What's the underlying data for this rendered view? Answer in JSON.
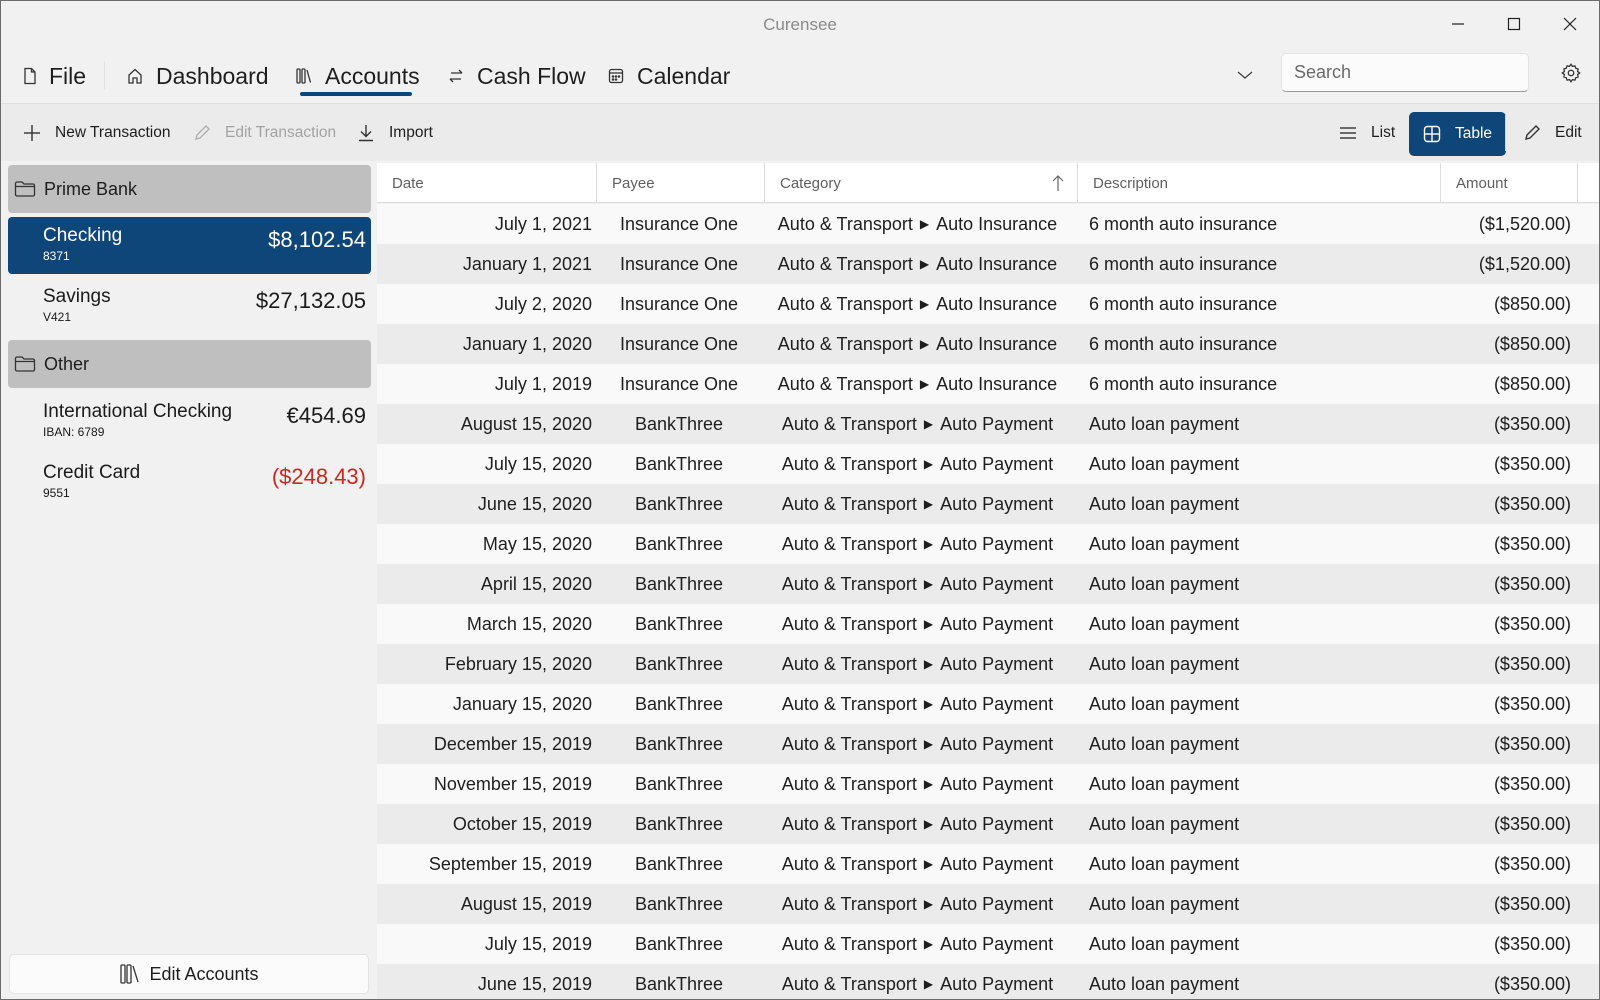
{
  "app": {
    "title": "Curensee"
  },
  "window_controls": {
    "minimize": "minimize-icon",
    "maximize": "maximize-icon",
    "close": "close-icon"
  },
  "nav": {
    "file": "File",
    "tabs": [
      {
        "label": "Dashboard",
        "icon": "home-icon"
      },
      {
        "label": "Accounts",
        "icon": "library-icon",
        "active": true
      },
      {
        "label": "Cash Flow",
        "icon": "swap-icon"
      },
      {
        "label": "Calendar",
        "icon": "calendar-icon"
      }
    ],
    "search_placeholder": "Search",
    "search_value": ""
  },
  "toolbar": {
    "new_transaction": "New Transaction",
    "edit_transaction": "Edit Transaction",
    "import": "Import",
    "list": "List",
    "table": "Table",
    "edit": "Edit",
    "active_view": "Table"
  },
  "sidebar": {
    "groups": [
      {
        "name": "Prime Bank",
        "accounts": [
          {
            "name": "Checking",
            "number": "8371",
            "balance": "$8,102.54",
            "selected": true
          },
          {
            "name": "Savings",
            "number": "V421",
            "balance": "$27,132.05"
          }
        ]
      },
      {
        "name": "Other",
        "accounts": [
          {
            "name": "International Checking",
            "number": "IBAN: 6789",
            "balance": "€454.69"
          },
          {
            "name": "Credit Card",
            "number": "9551",
            "balance": "($248.43)",
            "negative": true
          }
        ]
      }
    ],
    "edit_accounts": "Edit Accounts"
  },
  "table": {
    "columns": [
      "Date",
      "Payee",
      "Category",
      "Description",
      "Amount"
    ],
    "sorted_column": "Category",
    "sort_direction": "ascending",
    "rows": [
      {
        "date": "July 1, 2021",
        "payee": "Insurance One",
        "cat": "Auto & Transport",
        "sub": "Auto Insurance",
        "desc": "6 month auto insurance",
        "amount": "($1,520.00)"
      },
      {
        "date": "January 1, 2021",
        "payee": "Insurance One",
        "cat": "Auto & Transport",
        "sub": "Auto Insurance",
        "desc": "6 month auto insurance",
        "amount": "($1,520.00)"
      },
      {
        "date": "July 2, 2020",
        "payee": "Insurance One",
        "cat": "Auto & Transport",
        "sub": "Auto Insurance",
        "desc": "6 month auto insurance",
        "amount": "($850.00)"
      },
      {
        "date": "January 1, 2020",
        "payee": "Insurance One",
        "cat": "Auto & Transport",
        "sub": "Auto Insurance",
        "desc": "6 month auto insurance",
        "amount": "($850.00)"
      },
      {
        "date": "July 1, 2019",
        "payee": "Insurance One",
        "cat": "Auto & Transport",
        "sub": "Auto Insurance",
        "desc": "6 month auto insurance",
        "amount": "($850.00)"
      },
      {
        "date": "August 15, 2020",
        "payee": "BankThree",
        "cat": "Auto & Transport",
        "sub": "Auto Payment",
        "desc": "Auto loan payment",
        "amount": "($350.00)"
      },
      {
        "date": "July 15, 2020",
        "payee": "BankThree",
        "cat": "Auto & Transport",
        "sub": "Auto Payment",
        "desc": "Auto loan payment",
        "amount": "($350.00)"
      },
      {
        "date": "June 15, 2020",
        "payee": "BankThree",
        "cat": "Auto & Transport",
        "sub": "Auto Payment",
        "desc": "Auto loan payment",
        "amount": "($350.00)"
      },
      {
        "date": "May 15, 2020",
        "payee": "BankThree",
        "cat": "Auto & Transport",
        "sub": "Auto Payment",
        "desc": "Auto loan payment",
        "amount": "($350.00)"
      },
      {
        "date": "April 15, 2020",
        "payee": "BankThree",
        "cat": "Auto & Transport",
        "sub": "Auto Payment",
        "desc": "Auto loan payment",
        "amount": "($350.00)"
      },
      {
        "date": "March 15, 2020",
        "payee": "BankThree",
        "cat": "Auto & Transport",
        "sub": "Auto Payment",
        "desc": "Auto loan payment",
        "amount": "($350.00)"
      },
      {
        "date": "February 15, 2020",
        "payee": "BankThree",
        "cat": "Auto & Transport",
        "sub": "Auto Payment",
        "desc": "Auto loan payment",
        "amount": "($350.00)"
      },
      {
        "date": "January 15, 2020",
        "payee": "BankThree",
        "cat": "Auto & Transport",
        "sub": "Auto Payment",
        "desc": "Auto loan payment",
        "amount": "($350.00)"
      },
      {
        "date": "December 15, 2019",
        "payee": "BankThree",
        "cat": "Auto & Transport",
        "sub": "Auto Payment",
        "desc": "Auto loan payment",
        "amount": "($350.00)"
      },
      {
        "date": "November 15, 2019",
        "payee": "BankThree",
        "cat": "Auto & Transport",
        "sub": "Auto Payment",
        "desc": "Auto loan payment",
        "amount": "($350.00)"
      },
      {
        "date": "October 15, 2019",
        "payee": "BankThree",
        "cat": "Auto & Transport",
        "sub": "Auto Payment",
        "desc": "Auto loan payment",
        "amount": "($350.00)"
      },
      {
        "date": "September 15, 2019",
        "payee": "BankThree",
        "cat": "Auto & Transport",
        "sub": "Auto Payment",
        "desc": "Auto loan payment",
        "amount": "($350.00)"
      },
      {
        "date": "August 15, 2019",
        "payee": "BankThree",
        "cat": "Auto & Transport",
        "sub": "Auto Payment",
        "desc": "Auto loan payment",
        "amount": "($350.00)"
      },
      {
        "date": "July 15, 2019",
        "payee": "BankThree",
        "cat": "Auto & Transport",
        "sub": "Auto Payment",
        "desc": "Auto loan payment",
        "amount": "($350.00)"
      },
      {
        "date": "June 15, 2019",
        "payee": "BankThree",
        "cat": "Auto & Transport",
        "sub": "Auto Payment",
        "desc": "Auto loan payment",
        "amount": "($350.00)"
      }
    ]
  },
  "colors": {
    "accent": "#0f4679",
    "negative": "#c42b1c",
    "group_header": "#bfbfbf"
  }
}
